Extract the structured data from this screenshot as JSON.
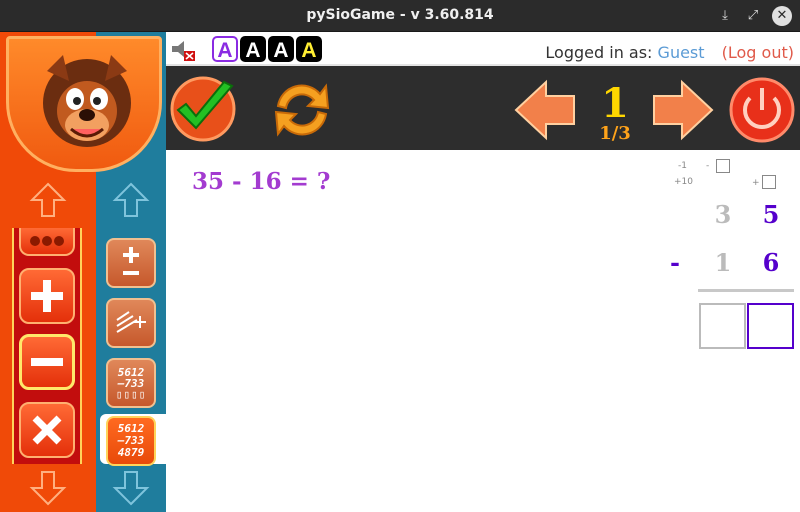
{
  "window": {
    "title": "pySioGame - v 3.60.814"
  },
  "statusbar": {
    "font_options": [
      "A",
      "A",
      "A",
      "A"
    ],
    "logged_in_label": "Logged in as:",
    "user": "Guest",
    "logout": "(Log out)"
  },
  "toolbar": {
    "page_number": "1",
    "page_fraction": "1/3"
  },
  "sidebar": {
    "games": [
      {
        "line1": "5612",
        "line2": "–733",
        "line3": ""
      },
      {
        "line1": "5612",
        "line2": "–733",
        "line3": "4879"
      }
    ]
  },
  "task": {
    "question": "35 - 16 = ?",
    "hint_minus": "-1",
    "hint_plus": "+10",
    "hint_minus_sign": "-",
    "hint_plus_sign": "+",
    "top_tens": "3",
    "top_ones": "5",
    "operator": "-",
    "bottom_tens": "1",
    "bottom_ones": "6"
  },
  "colors": {
    "accent": "#a33bd0",
    "sidebar_orange": "#f04a08",
    "sidebar_teal": "#1f7d9d",
    "page_number": "#ffd700",
    "answer_border": "#5500cc"
  }
}
